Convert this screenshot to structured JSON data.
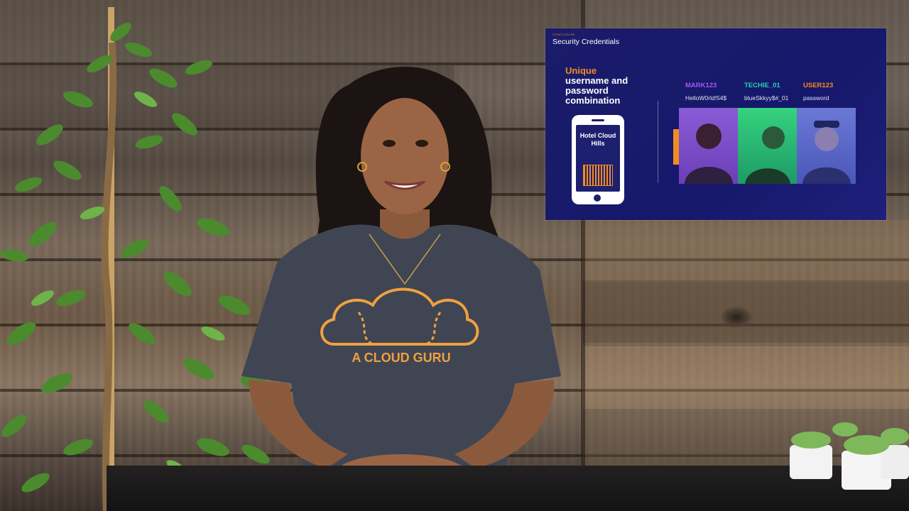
{
  "slide": {
    "eyebrow": "CONCLUSION",
    "title": "Security Credentials",
    "heading_accent": "Unique",
    "heading_rest": "username and password combination",
    "phone_label": "Hotel Cloud Hills",
    "users": [
      {
        "username": "MARK123",
        "password": "HelloW0rld!54$",
        "color": "#a855f7"
      },
      {
        "username": "TECHIE_01",
        "password": "blueSkkyy$#_01",
        "color": "#22d3b4"
      },
      {
        "username": "USER123",
        "password": "password",
        "color": "#f48b22"
      }
    ]
  },
  "shirt": {
    "text": "A CLOUD GURU"
  }
}
